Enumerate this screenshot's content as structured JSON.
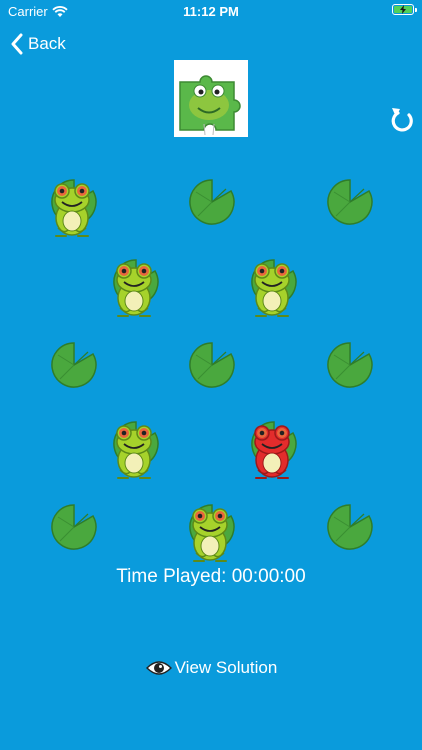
{
  "status": {
    "carrier": "Carrier",
    "time": "11:12 PM"
  },
  "nav": {
    "back_label": "Back"
  },
  "board": {
    "pads": [
      {
        "id": "r1c1",
        "frog": "green"
      },
      {
        "id": "r1c2",
        "frog": null
      },
      {
        "id": "r1c3",
        "frog": null
      },
      {
        "id": "r2c1",
        "frog": "green"
      },
      {
        "id": "r2c2",
        "frog": "green"
      },
      {
        "id": "r3c1",
        "frog": null
      },
      {
        "id": "r3c2",
        "frog": null
      },
      {
        "id": "r3c3",
        "frog": null
      },
      {
        "id": "r4c1",
        "frog": "green"
      },
      {
        "id": "r4c2",
        "frog": "red"
      },
      {
        "id": "r5c1",
        "frog": null
      },
      {
        "id": "r5c2",
        "frog": "green"
      },
      {
        "id": "r5c3",
        "frog": null
      }
    ]
  },
  "timer": {
    "label": "Time Played:",
    "value": "00:00:00"
  },
  "footer": {
    "solution_label": "View Solution"
  },
  "colors": {
    "background": "#0a9bdc",
    "pad": "#4aa83e",
    "frog_green": "#a6d22b",
    "frog_red": "#e32c2c"
  },
  "icons": {
    "back": "chevron-left-icon",
    "restart": "restart-icon",
    "eye": "eye-icon",
    "logo": "frog-puzzle-logo"
  }
}
